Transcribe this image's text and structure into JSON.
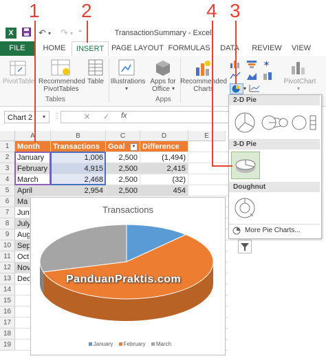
{
  "window": {
    "title": "TransactionSummary - Excel"
  },
  "callouts": [
    "1",
    "2",
    "4",
    "3"
  ],
  "tabs": {
    "file": "FILE",
    "home": "HOME",
    "insert": "INSERT",
    "page_layout": "PAGE LAYOUT",
    "formulas": "FORMULAS",
    "data": "DATA",
    "review": "REVIEW",
    "view": "VIEW"
  },
  "ribbon": {
    "pivottable": "PivotTable",
    "recommended_pivottables_1": "Recommended",
    "recommended_pivottables_2": "PivotTables",
    "table": "Table",
    "tables_group": "Tables",
    "illustrations": "Illustrations",
    "apps_for_office_1": "Apps for",
    "apps_for_office_2": "Office",
    "apps_group": "Apps",
    "recommended_charts_1": "Recommended",
    "recommended_charts_2": "Charts",
    "pivotchart": "PivotChart"
  },
  "formula_bar": {
    "name_box": "Chart 2",
    "cancel": "✕",
    "enter": "✓",
    "fx": "fx"
  },
  "columns": [
    "A",
    "B",
    "C",
    "D",
    "E"
  ],
  "rows": [
    "1",
    "2",
    "3",
    "4",
    "5",
    "6",
    "7",
    "8",
    "9",
    "10",
    "11",
    "12",
    "13",
    "14",
    "15",
    "16",
    "17",
    "18",
    "19"
  ],
  "table": {
    "headers": [
      "Month",
      "Transactions",
      "Goal",
      "Difference"
    ],
    "rows": [
      [
        "January",
        "1,006",
        "2,500",
        "(1,494)"
      ],
      [
        "February",
        "4,915",
        "2,500",
        "2,415"
      ],
      [
        "March",
        "2,468",
        "2,500",
        "(32)"
      ],
      [
        "April",
        "2,954",
        "2,500",
        "454"
      ]
    ],
    "partial_months": [
      "Ma",
      "Jun",
      "July",
      "Aug",
      "Sep",
      "Oct",
      "Nov",
      "Dec"
    ]
  },
  "chart": {
    "title": "Transactions",
    "watermark": "PanduanPraktis.com"
  },
  "chart_data": {
    "type": "pie",
    "title": "Transactions",
    "categories": [
      "January",
      "February",
      "March"
    ],
    "values": [
      1006,
      4915,
      2468
    ],
    "colors": [
      "#5b9bd5",
      "#ed7d31",
      "#a5a5a5"
    ],
    "legend": "bottom"
  },
  "gallery": {
    "section_2d": "2-D Pie",
    "section_3d": "3-D Pie",
    "section_doughnut": "Doughnut",
    "more": "More Pie Charts..."
  },
  "colors": {
    "excel_green": "#217346",
    "header_orange": "#ed7d31",
    "callout_red": "#e34234"
  }
}
